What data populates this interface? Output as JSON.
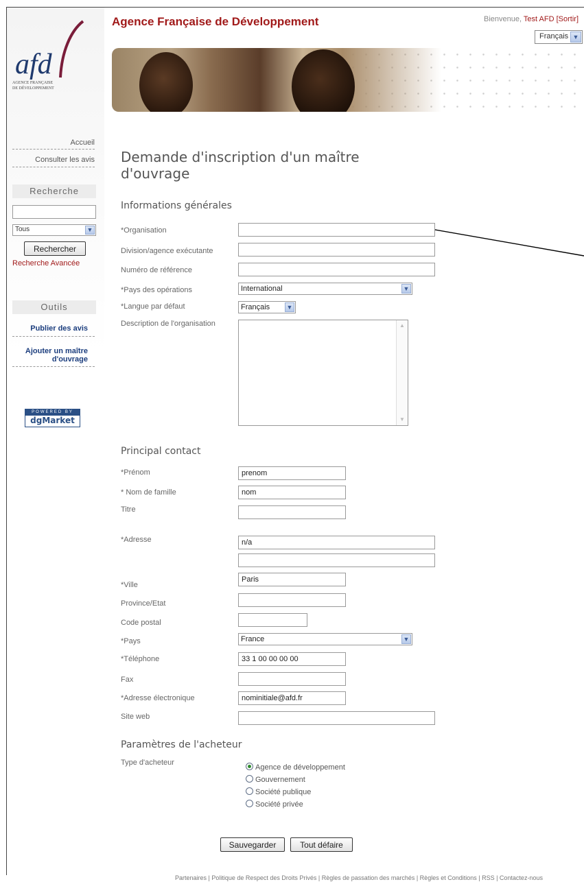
{
  "header": {
    "site_title": "Agence Française de Développement",
    "welcome_prefix": "Bienvenue,",
    "user": "Test AFD [Sortir]",
    "language": "Français"
  },
  "logo": {
    "mark": "afd",
    "line1": "Agence Française",
    "line2": "de Développement"
  },
  "sidebar": {
    "home": "Accueil",
    "notices": "Consulter les avis",
    "search_heading": "Recherche",
    "search_filter": "Tous",
    "search_button": "Rechercher",
    "advanced_search": "Recherche Avancée",
    "tools_heading": "Outils",
    "publish": "Publier des avis",
    "add_owner_line1": "Ajouter un maître",
    "add_owner_line2": "d'ouvrage",
    "powered_by": "POWERED BY",
    "powered_brand": "dgMarket"
  },
  "page": {
    "title": "Demande d'inscription d'un maître d'ouvrage"
  },
  "general": {
    "heading": "Informations générales",
    "organisation_label": "*Organisation",
    "division_label": "Division/agence exécutante",
    "reference_label": "Numéro de référence",
    "country_ops_label": "*Pays des opérations",
    "country_ops_value": "International",
    "default_lang_label": "*Langue par défaut",
    "default_lang_value": "Français",
    "description_label": "Description de l'organisation"
  },
  "contact": {
    "heading": "Principal contact",
    "firstname_label": "*Prénom",
    "firstname_value": "prenom",
    "lastname_label": "* Nom de famille",
    "lastname_value": "nom",
    "title_label": "Titre",
    "address_label": "*Adresse",
    "address1_value": "n/a",
    "city_label": "*Ville",
    "city_value": "Paris",
    "province_label": "Province/Etat",
    "postal_label": "Code postal",
    "country_label": "*Pays",
    "country_value": "France",
    "phone_label": "*Téléphone",
    "phone_value": "33 1 00 00 00 00",
    "fax_label": "Fax",
    "email_label": "*Adresse électronique",
    "email_value": "nominitiale@afd.fr",
    "website_label": "Site web"
  },
  "buyer": {
    "heading": "Paramètres de l'acheteur",
    "type_label": "Type d'acheteur",
    "options": [
      "Agence de développement",
      "Gouvernement",
      "Société publique",
      "Société privée"
    ],
    "selected": "Agence de développement"
  },
  "actions": {
    "save": "Sauvegarder",
    "reset": "Tout défaire"
  },
  "footer": {
    "links": "Partenaires | Politique de Respect des Droits Privés | Règles de passation des marchés | Règles et Conditions | RSS | Contactez-nous"
  }
}
